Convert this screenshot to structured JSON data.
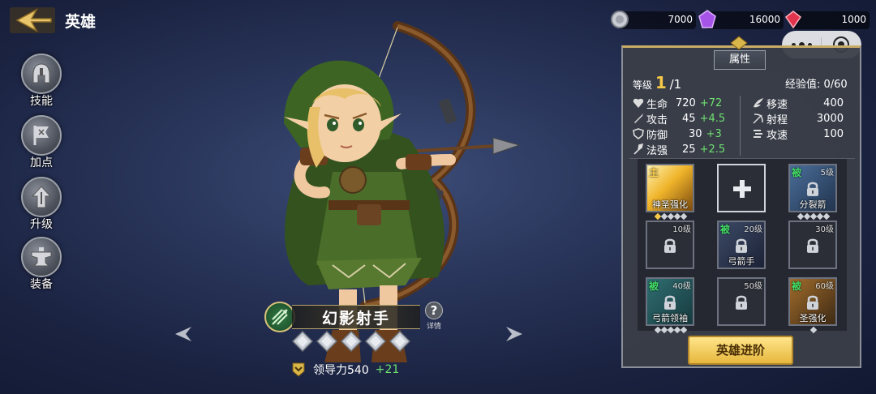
{
  "header": {
    "title": "英雄"
  },
  "currencies": [
    {
      "icon": "silver-coin-icon",
      "value": "7000"
    },
    {
      "icon": "purple-gem-icon",
      "value": "16000"
    },
    {
      "icon": "red-gem-icon",
      "value": "1000"
    }
  ],
  "side_menu": [
    {
      "icon": "helmet-icon",
      "label": "技能"
    },
    {
      "icon": "flag-icon",
      "label": "加点"
    },
    {
      "icon": "upgrade-arrow-icon",
      "label": "升级"
    },
    {
      "icon": "anvil-icon",
      "label": "装备"
    }
  ],
  "hero": {
    "name": "幻影射手",
    "detail_label": "详情",
    "stars": 5,
    "leadership_label": "领导力540",
    "leadership_bonus": "+21"
  },
  "panel": {
    "tab_label": "属性",
    "level_label": "等级",
    "level_value": "1",
    "level_max": "/1",
    "exp_label": "经验值: 0/60",
    "stats_left": [
      {
        "icon": "heart-icon",
        "label": "生命",
        "value": "720",
        "bonus": "+72"
      },
      {
        "icon": "sword-icon",
        "label": "攻击",
        "value": "45",
        "bonus": "+4.5"
      },
      {
        "icon": "shield-icon",
        "label": "防御",
        "value": "30",
        "bonus": "+3"
      },
      {
        "icon": "magic-icon",
        "label": "法强",
        "value": "25",
        "bonus": "+2.5"
      }
    ],
    "stats_right": [
      {
        "icon": "wing-icon",
        "label": "移速",
        "value": "400"
      },
      {
        "icon": "bow-icon",
        "label": "射程",
        "value": "3000"
      },
      {
        "icon": "speed-icon",
        "label": "攻速",
        "value": "100"
      }
    ],
    "skills": [
      {
        "type": "active",
        "tag": "主",
        "name": "神圣强化",
        "req": "",
        "locked": false,
        "stars": 5,
        "art": "gold"
      },
      {
        "type": "add",
        "tag": "",
        "name": "",
        "req": "",
        "locked": false,
        "stars": 0,
        "art": "plus"
      },
      {
        "type": "passive",
        "tag": "被",
        "name": "分裂箭",
        "req": "5级",
        "locked": true,
        "stars": 5,
        "art": "blue"
      },
      {
        "type": "empty",
        "tag": "",
        "name": "",
        "req": "10级",
        "locked": true,
        "stars": 0,
        "art": "none"
      },
      {
        "type": "passive",
        "tag": "被",
        "name": "弓箭手",
        "req": "20级",
        "locked": true,
        "stars": 0,
        "art": "dark"
      },
      {
        "type": "empty",
        "tag": "",
        "name": "",
        "req": "30级",
        "locked": true,
        "stars": 0,
        "art": "none"
      },
      {
        "type": "passive",
        "tag": "被",
        "name": "弓箭领袖",
        "req": "40级",
        "locked": true,
        "stars": 5,
        "art": "teal"
      },
      {
        "type": "empty",
        "tag": "",
        "name": "",
        "req": "50级",
        "locked": true,
        "stars": 0,
        "art": "none"
      },
      {
        "type": "passive",
        "tag": "被",
        "name": "圣强化",
        "req": "60级",
        "locked": true,
        "stars": 1,
        "art": "bronze"
      }
    ],
    "advance_label": "英雄进阶"
  },
  "colors": {
    "accent_gold": "#f7c948",
    "bonus_green": "#6fe06f",
    "passive_green": "#44dd66"
  }
}
